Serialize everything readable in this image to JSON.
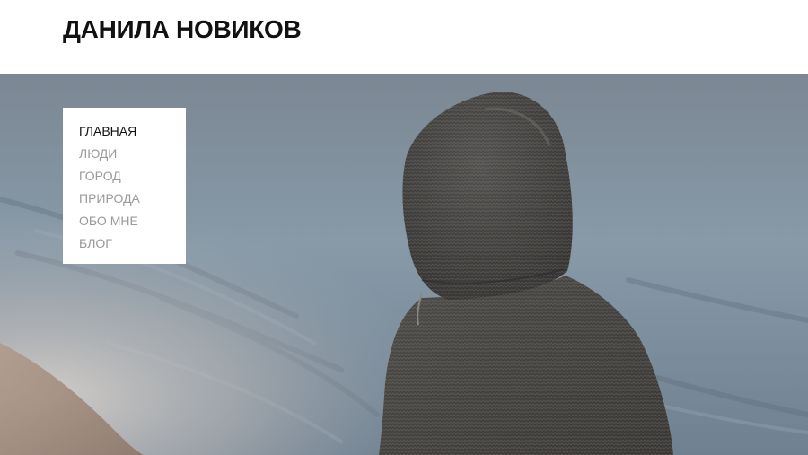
{
  "site": {
    "title": "ДАНИЛА НОВИКОВ"
  },
  "nav": {
    "items": [
      {
        "label": "ГЛАВНАЯ",
        "active": true
      },
      {
        "label": "ЛЮДИ",
        "active": false
      },
      {
        "label": "ГОРОД",
        "active": false
      },
      {
        "label": "ПРИРОДА",
        "active": false
      },
      {
        "label": "ОБО МНЕ",
        "active": false
      },
      {
        "label": "БЛОГ",
        "active": false
      }
    ]
  },
  "hero": {
    "image_subject": "person-in-hooded-sweater-by-sea"
  },
  "colors": {
    "title": "#111111",
    "nav_active": "#111111",
    "nav_inactive": "#9a9a9a",
    "menu_background": "#ffffff",
    "sea": "#7f8c99",
    "sweater": "#4a4846"
  }
}
